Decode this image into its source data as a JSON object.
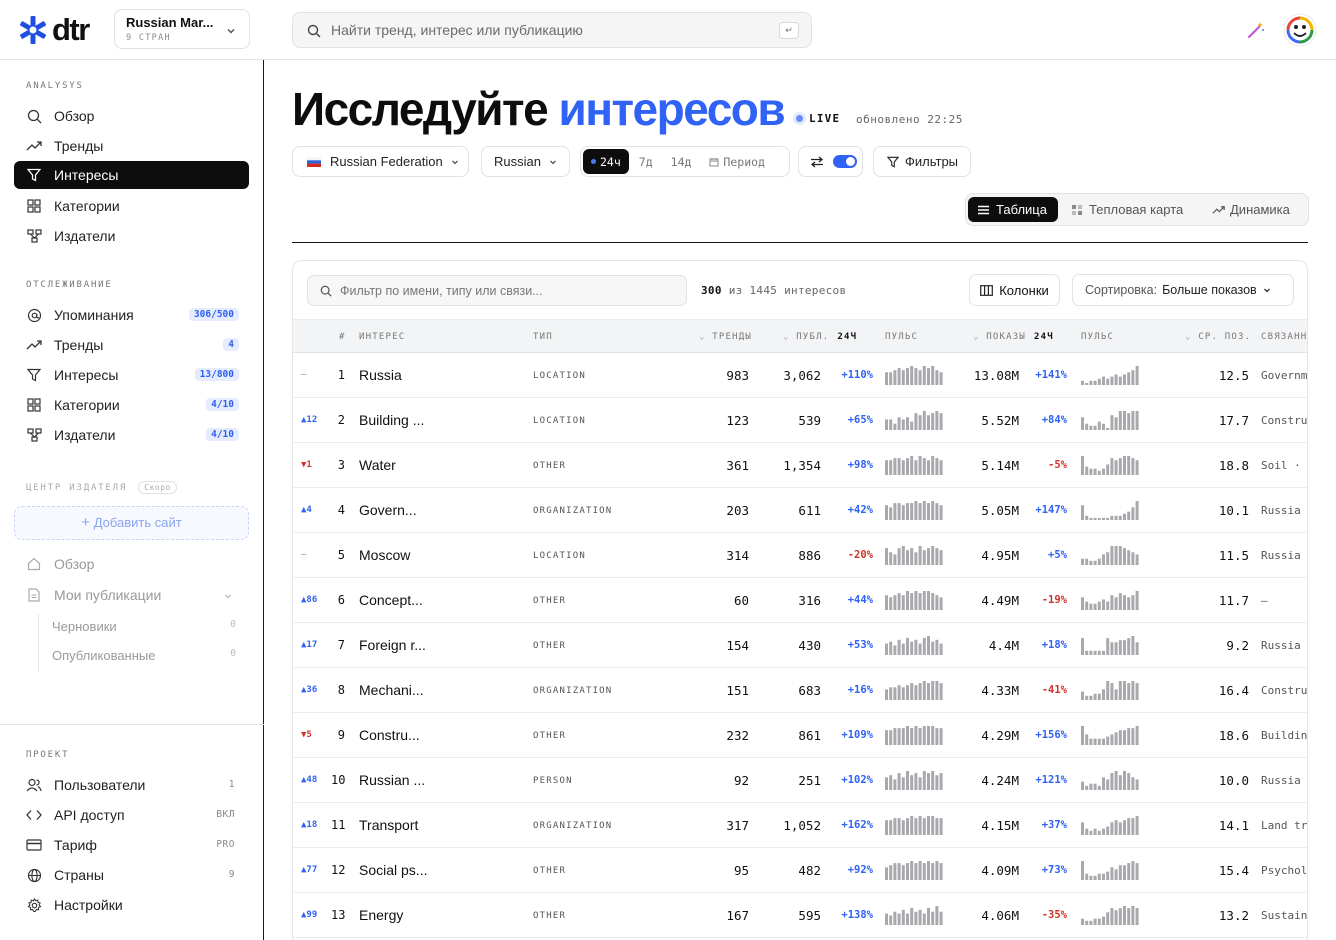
{
  "topbar": {
    "logo_text": "dtr",
    "workspace_name": "Russian Mar...",
    "workspace_sub": "9 СТРАН",
    "search_placeholder": "Найти тренд, интерес или публикацию",
    "search_kbd": "↵"
  },
  "sidebar": {
    "analysis_label": "ANALYSYS",
    "analysis_items": [
      {
        "label": "Обзор",
        "icon": "search-icon"
      },
      {
        "label": "Тренды",
        "icon": "trend-icon"
      },
      {
        "label": "Интересы",
        "icon": "filter-icon",
        "active": true
      },
      {
        "label": "Категории",
        "icon": "grid-icon"
      },
      {
        "label": "Издатели",
        "icon": "publisher-icon"
      }
    ],
    "tracking_label": "ОТСЛЕЖИВАНИЕ",
    "tracking_items": [
      {
        "label": "Упоминания",
        "badge": "306/500"
      },
      {
        "label": "Тренды",
        "badge": "4"
      },
      {
        "label": "Интересы",
        "badge": "13/800"
      },
      {
        "label": "Категории",
        "badge": "4/10"
      },
      {
        "label": "Издатели",
        "badge": "4/10"
      }
    ],
    "publisher_label": "ЦЕНТР ИЗДАТЕЛЯ",
    "publisher_soon": "Скоро",
    "add_site": "Добавить сайт",
    "pub_overview": "Обзор",
    "pub_my": "Мои публикации",
    "pub_drafts": "Черновики",
    "pub_drafts_count": "0",
    "pub_published": "Опубликованные",
    "pub_published_count": "0",
    "project_label": "ПРОЕКТ",
    "project_items": [
      {
        "label": "Пользователи",
        "tail": "1"
      },
      {
        "label": "API доступ",
        "tail": "ВКЛ"
      },
      {
        "label": "Тариф",
        "tail": "PRO"
      },
      {
        "label": "Страны",
        "tail": "9"
      },
      {
        "label": "Настройки",
        "tail": ""
      }
    ]
  },
  "header": {
    "title_a": "Исследуйте ",
    "title_b": "интересов",
    "live": "LIVE",
    "updated": "обновлено 22:25"
  },
  "controls": {
    "country": "Russian Federation",
    "language": "Russian",
    "periods": [
      "24ч",
      "7д",
      "14д"
    ],
    "period_custom": "Период",
    "filters": "Фильтры"
  },
  "views": {
    "table": "Таблица",
    "heatmap": "Тепловая карта",
    "dynamics": "Динамика"
  },
  "panel": {
    "filter_placeholder": "Фильтр по имени, типу или связи...",
    "count_a": "300",
    "count_b": "из 1445 интересов",
    "columns_btn": "Колонки",
    "sort_label": "Сортировка:",
    "sort_value": "Больше показов"
  },
  "table": {
    "headers": {
      "num": "#",
      "interest": "ИНТЕРЕС",
      "type": "ТИП",
      "trends": "ТРЕНДЫ",
      "pubs": "ПУБЛ.",
      "pubs_period": "24Ч",
      "pulse1": "ПУЛЬС",
      "views": "ПОКАЗЫ",
      "views_period": "24Ч",
      "pulse2": "ПУЛЬС",
      "avg": "СР. ПОЗ.",
      "related": "СВЯЗАННЫЕ"
    },
    "rows": [
      {
        "delta": "—",
        "dir": "flat",
        "num": "1",
        "name": "Russia",
        "type": "LOCATION",
        "trends": "983",
        "pubs": "3,062",
        "pchg": "+110%",
        "pdir": "pos",
        "views": "13.08M",
        "vchg": "+141%",
        "vdir": "pos",
        "avg": "12.5",
        "rel": "Governm",
        "p1": [
          6,
          6,
          7,
          8,
          7,
          8,
          9,
          8,
          7,
          9,
          8,
          9,
          7,
          6
        ],
        "p2": [
          2,
          1,
          2,
          2,
          3,
          4,
          3,
          4,
          5,
          4,
          5,
          6,
          7,
          9
        ]
      },
      {
        "delta": "▲12",
        "dir": "up",
        "num": "2",
        "name": "Building ...",
        "type": "LOCATION",
        "trends": "123",
        "pubs": "539",
        "pchg": "+65%",
        "pdir": "pos",
        "views": "5.52M",
        "vchg": "+84%",
        "vdir": "pos",
        "avg": "17.7",
        "rel": "Constru",
        "p1": [
          5,
          5,
          3,
          6,
          5,
          6,
          4,
          8,
          7,
          9,
          7,
          8,
          9,
          8
        ],
        "p2": [
          6,
          3,
          2,
          2,
          4,
          3,
          1,
          7,
          6,
          9,
          9,
          8,
          9,
          9
        ]
      },
      {
        "delta": "▼1",
        "dir": "down",
        "num": "3",
        "name": "Water",
        "type": "OTHER",
        "trends": "361",
        "pubs": "1,354",
        "pchg": "+98%",
        "pdir": "pos",
        "views": "5.14M",
        "vchg": "-5%",
        "vdir": "neg",
        "avg": "18.8",
        "rel": "Soil ·",
        "p1": [
          7,
          7,
          8,
          8,
          7,
          8,
          9,
          7,
          9,
          8,
          7,
          9,
          8,
          7
        ],
        "p2": [
          9,
          4,
          3,
          3,
          2,
          3,
          5,
          8,
          7,
          8,
          9,
          9,
          8,
          7
        ]
      },
      {
        "delta": "▲4",
        "dir": "up",
        "num": "4",
        "name": "Govern...",
        "type": "ORGANIZATION",
        "trends": "203",
        "pubs": "611",
        "pchg": "+42%",
        "pdir": "pos",
        "views": "5.05M",
        "vchg": "+147%",
        "vdir": "pos",
        "avg": "10.1",
        "rel": "Russia",
        "p1": [
          7,
          6,
          8,
          8,
          7,
          8,
          8,
          9,
          8,
          9,
          8,
          9,
          8,
          7
        ],
        "p2": [
          7,
          2,
          1,
          1,
          1,
          1,
          1,
          2,
          2,
          2,
          3,
          4,
          6,
          9
        ]
      },
      {
        "delta": "—",
        "dir": "flat",
        "num": "5",
        "name": "Moscow",
        "type": "LOCATION",
        "trends": "314",
        "pubs": "886",
        "pchg": "-20%",
        "pdir": "neg",
        "views": "4.95M",
        "vchg": "+5%",
        "vdir": "pos",
        "avg": "11.5",
        "rel": "Russia",
        "p1": [
          8,
          6,
          5,
          8,
          9,
          7,
          8,
          6,
          9,
          7,
          8,
          9,
          8,
          7
        ],
        "p2": [
          3,
          3,
          2,
          2,
          3,
          5,
          6,
          9,
          9,
          9,
          8,
          7,
          6,
          5
        ]
      },
      {
        "delta": "▲86",
        "dir": "up",
        "num": "6",
        "name": "Concept...",
        "type": "OTHER",
        "trends": "60",
        "pubs": "316",
        "pchg": "+44%",
        "pdir": "pos",
        "views": "4.49M",
        "vchg": "-19%",
        "vdir": "neg",
        "avg": "11.7",
        "rel": "—",
        "p1": [
          7,
          6,
          7,
          8,
          7,
          9,
          8,
          9,
          8,
          9,
          9,
          8,
          7,
          6
        ],
        "p2": [
          6,
          4,
          3,
          3,
          4,
          5,
          4,
          7,
          6,
          8,
          7,
          6,
          7,
          9
        ]
      },
      {
        "delta": "▲17",
        "dir": "up",
        "num": "7",
        "name": "Foreign r...",
        "type": "OTHER",
        "trends": "154",
        "pubs": "430",
        "pchg": "+53%",
        "pdir": "pos",
        "views": "4.4M",
        "vchg": "+18%",
        "vdir": "pos",
        "avg": "9.2",
        "rel": "Russia",
        "p1": [
          6,
          7,
          5,
          8,
          6,
          9,
          7,
          8,
          6,
          9,
          10,
          7,
          8,
          6
        ],
        "p2": [
          8,
          2,
          2,
          2,
          2,
          2,
          8,
          6,
          6,
          7,
          7,
          8,
          9,
          6
        ]
      },
      {
        "delta": "▲36",
        "dir": "up",
        "num": "8",
        "name": "Mechani...",
        "type": "ORGANIZATION",
        "trends": "151",
        "pubs": "683",
        "pchg": "+16%",
        "pdir": "pos",
        "views": "4.33M",
        "vchg": "-41%",
        "vdir": "neg",
        "avg": "16.4",
        "rel": "Constru",
        "p1": [
          5,
          6,
          6,
          7,
          6,
          7,
          8,
          7,
          8,
          9,
          8,
          9,
          9,
          8
        ],
        "p2": [
          4,
          2,
          2,
          3,
          3,
          5,
          9,
          8,
          5,
          9,
          9,
          8,
          9,
          8
        ]
      },
      {
        "delta": "▼5",
        "dir": "down",
        "num": "9",
        "name": "Constru...",
        "type": "OTHER",
        "trends": "232",
        "pubs": "861",
        "pchg": "+109%",
        "pdir": "pos",
        "views": "4.29M",
        "vchg": "+156%",
        "vdir": "pos",
        "avg": "18.6",
        "rel": "Buildin",
        "p1": [
          7,
          7,
          8,
          8,
          8,
          9,
          8,
          9,
          8,
          9,
          9,
          9,
          8,
          8
        ],
        "p2": [
          9,
          5,
          3,
          3,
          3,
          3,
          4,
          5,
          6,
          7,
          7,
          8,
          8,
          9
        ]
      },
      {
        "delta": "▲48",
        "dir": "up",
        "num": "10",
        "name": "Russian ...",
        "type": "PERSON",
        "trends": "92",
        "pubs": "251",
        "pchg": "+102%",
        "pdir": "pos",
        "views": "4.24M",
        "vchg": "+121%",
        "vdir": "pos",
        "avg": "10.0",
        "rel": "Russia",
        "p1": [
          6,
          7,
          5,
          8,
          6,
          9,
          7,
          8,
          6,
          9,
          8,
          9,
          7,
          8
        ],
        "p2": [
          4,
          2,
          3,
          3,
          2,
          6,
          5,
          8,
          9,
          7,
          9,
          8,
          6,
          5
        ]
      },
      {
        "delta": "▲18",
        "dir": "up",
        "num": "11",
        "name": "Transport",
        "type": "ORGANIZATION",
        "trends": "317",
        "pubs": "1,052",
        "pchg": "+162%",
        "pdir": "pos",
        "views": "4.15M",
        "vchg": "+37%",
        "vdir": "pos",
        "avg": "14.1",
        "rel": "Land tr",
        "p1": [
          7,
          7,
          8,
          8,
          7,
          8,
          9,
          8,
          9,
          8,
          9,
          9,
          8,
          8
        ],
        "p2": [
          6,
          3,
          2,
          3,
          2,
          3,
          4,
          6,
          7,
          6,
          7,
          8,
          8,
          9
        ]
      },
      {
        "delta": "▲77",
        "dir": "up",
        "num": "12",
        "name": "Social ps...",
        "type": "OTHER",
        "trends": "95",
        "pubs": "482",
        "pchg": "+92%",
        "pdir": "pos",
        "views": "4.09M",
        "vchg": "+73%",
        "vdir": "pos",
        "avg": "15.4",
        "rel": "Psychol",
        "p1": [
          6,
          7,
          8,
          8,
          7,
          8,
          9,
          8,
          9,
          8,
          9,
          8,
          9,
          8
        ],
        "p2": [
          9,
          3,
          2,
          2,
          3,
          3,
          4,
          6,
          5,
          7,
          7,
          8,
          9,
          8
        ]
      },
      {
        "delta": "▲99",
        "dir": "up",
        "num": "13",
        "name": "Energy",
        "type": "OTHER",
        "trends": "167",
        "pubs": "595",
        "pchg": "+138%",
        "pdir": "pos",
        "views": "4.06M",
        "vchg": "-35%",
        "vdir": "neg",
        "avg": "13.2",
        "rel": "Sustain",
        "p1": [
          6,
          5,
          7,
          6,
          8,
          6,
          9,
          7,
          8,
          6,
          9,
          7,
          10,
          7
        ],
        "p2": [
          3,
          2,
          2,
          3,
          3,
          4,
          6,
          8,
          7,
          8,
          9,
          8,
          9,
          8
        ]
      }
    ]
  }
}
